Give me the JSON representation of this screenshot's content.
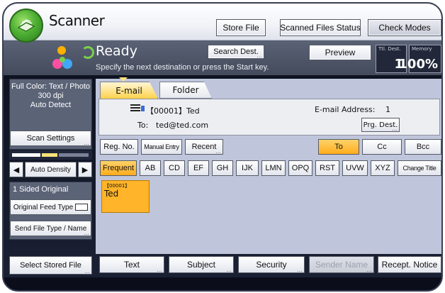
{
  "header": {
    "app_title": "Scanner",
    "store_file": "Store File",
    "scanned_files_status": "Scanned Files Status",
    "check_modes": "Check Modes"
  },
  "status": {
    "ready": "Ready",
    "instruction": "Specify the next destination or press the Start key.",
    "search_dest": "Search Dest.",
    "preview": "Preview",
    "ttl_dest_label": "Ttl. Dest.",
    "ttl_dest_value": "1",
    "memory_label": "Memory",
    "memory_value": "100%"
  },
  "left_panel": {
    "settings_lines": [
      "Full Color: Text / Photo",
      "300 dpi",
      "Auto Detect"
    ],
    "scan_settings": "Scan Settings",
    "density": "Auto Density",
    "left_arrow": "◀",
    "right_arrow": "▶",
    "sided": "1 Sided Original",
    "feed_type": "Original Feed Type",
    "send_file_type": "Send File Type / Name",
    "select_stored_file": "Select Stored File"
  },
  "tabs": [
    {
      "label": "E-mail",
      "active": true
    },
    {
      "label": "Folder",
      "active": false
    }
  ],
  "destination": {
    "name": "【00001】Ted",
    "to_label": "To:",
    "to_value": "ted@ted.com",
    "email_address_label": "E-mail Address:",
    "email_address_count": "1",
    "prg_dest": "Prg. Dest."
  },
  "row1": {
    "reg_no": "Reg. No.",
    "manual_entry": "Manual Entry",
    "recent": "Recent",
    "to": "To",
    "cc": "Cc",
    "bcc": "Bcc"
  },
  "categories": [
    "Frequent",
    "AB",
    "CD",
    "EF",
    "GH",
    "IJK",
    "LMN",
    "OPQ",
    "RST",
    "UVW",
    "XYZ",
    "Change Title"
  ],
  "entries": [
    {
      "number": "【00001】",
      "name": "Ted"
    }
  ],
  "bottom": {
    "text": "Text",
    "subject": "Subject",
    "security": "Security",
    "sender_name": "Sender Name",
    "recept_notice": "Recept. Notice"
  },
  "colors": {
    "accent_orange": "#ffac1c",
    "panel_blue": "#bfc6dc",
    "status_bar": "#4b5264"
  }
}
